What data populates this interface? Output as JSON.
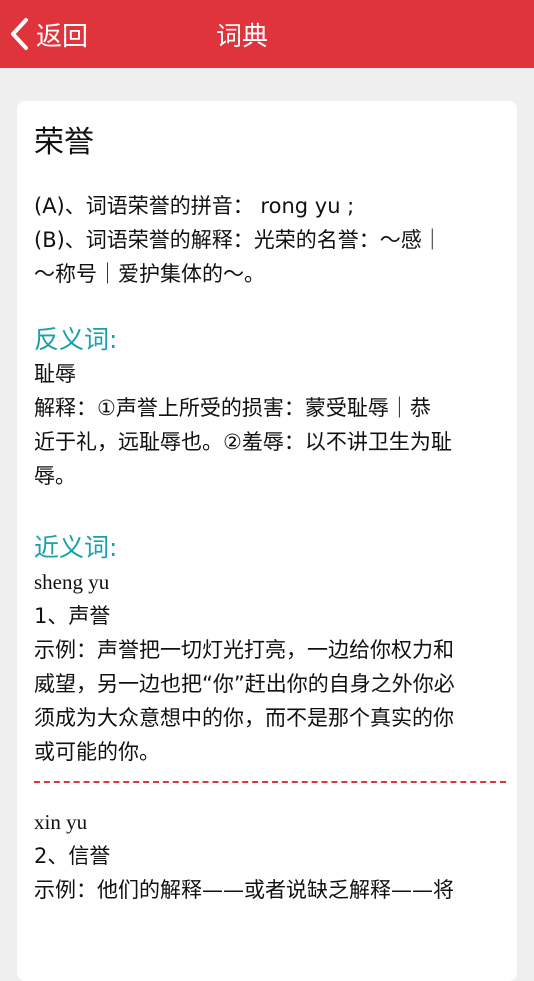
{
  "navbar": {
    "back_label": "返回",
    "title": "词典"
  },
  "entry": {
    "word": "荣誉",
    "pinyin_line": "(A)、词语荣誉的拼音： rong yu ;",
    "definition_line1": "(B)、词语荣誉的解释：光荣的名誉：～感｜",
    "definition_line2": "～称号｜爱护集体的～。"
  },
  "antonym": {
    "heading": "反义词:",
    "word": "耻辱",
    "explain_line1": "解释：①声誉上所受的损害：蒙受耻辱｜恭",
    "explain_line2": "近于礼，远耻辱也。②羞辱：以不讲卫生为耻",
    "explain_line3": "辱。"
  },
  "synonyms": {
    "heading": "近义词:",
    "items": [
      {
        "pinyin": "sheng yu",
        "word": "1、声誉",
        "example_lines": [
          "示例：声誉把一切灯光打亮，一边给你权力和",
          "威望，另一边也把“你”赶出你的自身之外你必",
          "须成为大众意想中的你，而不是那个真实的你",
          "或可能的你。"
        ]
      },
      {
        "pinyin": "xin yu",
        "word": "2、信誉",
        "example_lines": [
          "示例：他们的解释——或者说缺乏解释——将"
        ]
      }
    ]
  },
  "colors": {
    "navbar_bg": "#e0343d",
    "section_heading": "#1aa0ad",
    "divider": "#e0343d",
    "page_bg": "#efefef"
  },
  "icons": {
    "back": "chevron-left-icon"
  }
}
